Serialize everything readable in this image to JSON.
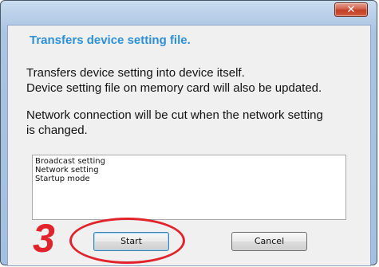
{
  "window": {
    "close_glyph": "✕"
  },
  "dialog": {
    "heading": "Transfers device setting file.",
    "description_lines": [
      "Transfers device setting into device itself.",
      "Device setting file on memory card will also be updated."
    ],
    "warning_lines": [
      "Network connection will be cut when the network setting",
      "is changed."
    ],
    "items": [
      "Broadcast setting",
      "Network setting",
      "Startup mode"
    ],
    "buttons": {
      "start": "Start",
      "cancel": "Cancel"
    }
  },
  "annotation": {
    "step_number": "3",
    "color": "#e0242c"
  },
  "colors": {
    "heading": "#2e8fd6",
    "frame": "#a4c0e0",
    "close_button": "#c13f27"
  }
}
